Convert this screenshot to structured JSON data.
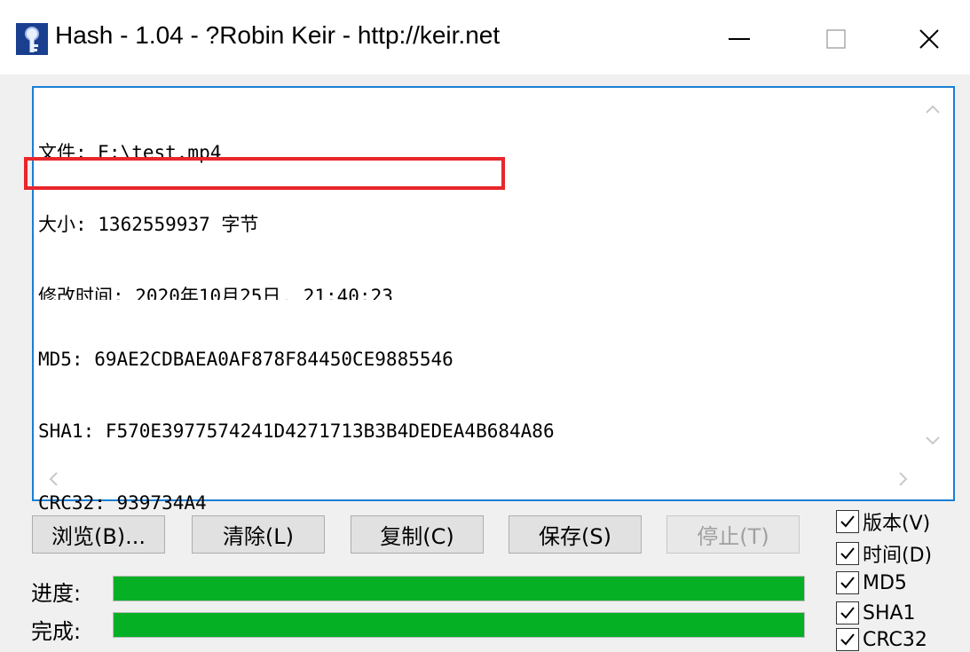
{
  "window": {
    "title": "Hash - 1.04 - ?Robin Keir - http://keir.net"
  },
  "output": {
    "lines": [
      "文件: E:\\test.mp4",
      "大小: 1362559937 字节",
      "修改时间: 2020年10月25日, 21:40:23",
      "MD5: 69AE2CDBAEA0AF878F84450CE9885546",
      "SHA1: F570E3977574241D4271713B3B4DEDEA4B684A86",
      "CRC32: 939734A4"
    ]
  },
  "buttons": {
    "browse": "浏览(B)...",
    "clear": "清除(L)",
    "copy": "复制(C)",
    "save": "保存(S)",
    "stop": "停止(T)"
  },
  "progress": {
    "label": "进度:",
    "value": 1.0
  },
  "complete": {
    "label": "完成:",
    "value": 1.0
  },
  "options": [
    {
      "label": "版本(V)",
      "checked": true
    },
    {
      "label": "时间(D)",
      "checked": true
    },
    {
      "label": "MD5",
      "checked": true
    },
    {
      "label": "SHA1",
      "checked": true
    },
    {
      "label": "CRC32",
      "checked": true
    }
  ],
  "colors": {
    "accent": "#1a7fd4",
    "progress": "#06b025",
    "highlight": "#e8262b"
  }
}
